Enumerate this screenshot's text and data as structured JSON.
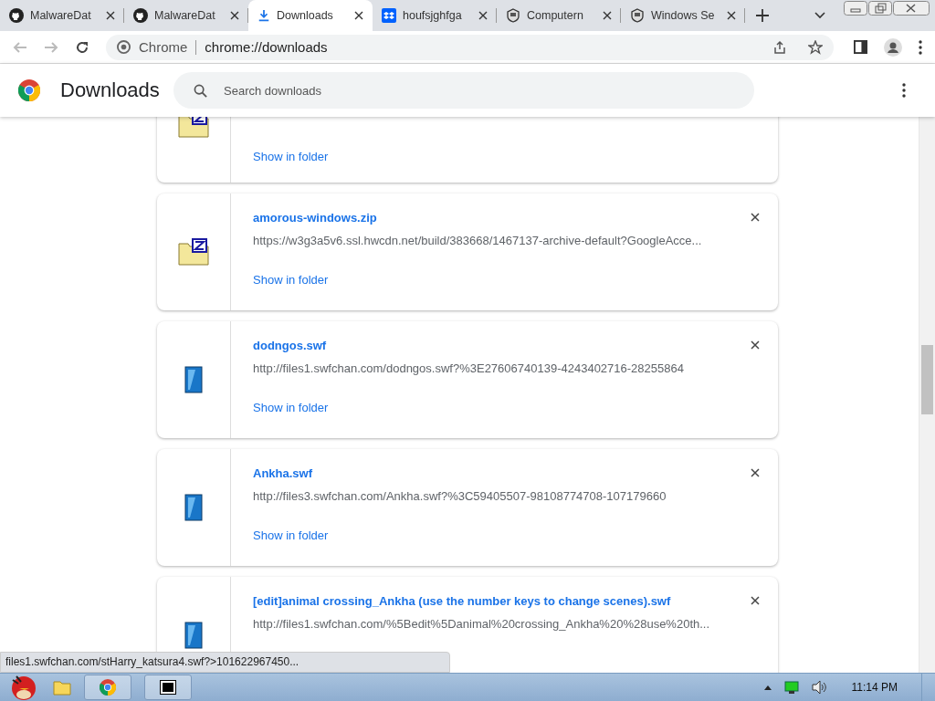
{
  "tabs": [
    {
      "title": "MalwareDat",
      "kind": "github",
      "selected": false
    },
    {
      "title": "MalwareDat",
      "kind": "github",
      "selected": false
    },
    {
      "title": "Downloads",
      "kind": "download",
      "selected": true
    },
    {
      "title": "houfsjghfga",
      "kind": "dropbox",
      "selected": false
    },
    {
      "title": "Computern",
      "kind": "badge",
      "selected": false
    },
    {
      "title": "Windows Se",
      "kind": "badge",
      "selected": false
    }
  ],
  "address_bar": {
    "site": "Chrome",
    "url": "chrome://downloads"
  },
  "header": {
    "title": "Downloads",
    "search": {
      "placeholder": "Search downloads"
    }
  },
  "downloads": [
    {
      "kind": "zip",
      "action": "Show in folder"
    },
    {
      "kind": "zip",
      "name": "amorous-windows.zip",
      "url": "https://w3g3a5v6.ssl.hwcdn.net/build/383668/1467137-archive-default?GoogleAcce...",
      "action": "Show in folder"
    },
    {
      "kind": "swf",
      "name": "dodngos.swf",
      "url": "http://files1.swfchan.com/dodngos.swf?%3E27606740139-4243402716-28255864",
      "action": "Show in folder"
    },
    {
      "kind": "swf",
      "name": "Ankha.swf",
      "url": "http://files3.swfchan.com/Ankha.swf?%3C59405507-98108774708-107179660",
      "action": "Show in folder"
    },
    {
      "kind": "swf",
      "name": "[edit]animal crossing_Ankha (use the number keys to change scenes).swf",
      "url": "http://files1.swfchan.com/%5Bedit%5Danimal%20crossing_Ankha%20%28use%20th..."
    }
  ],
  "status_bubble": "files1.swfchan.com/stHarry_katsura4.swf?>101622967450...",
  "taskbar": {
    "clock": "11:14 PM"
  }
}
